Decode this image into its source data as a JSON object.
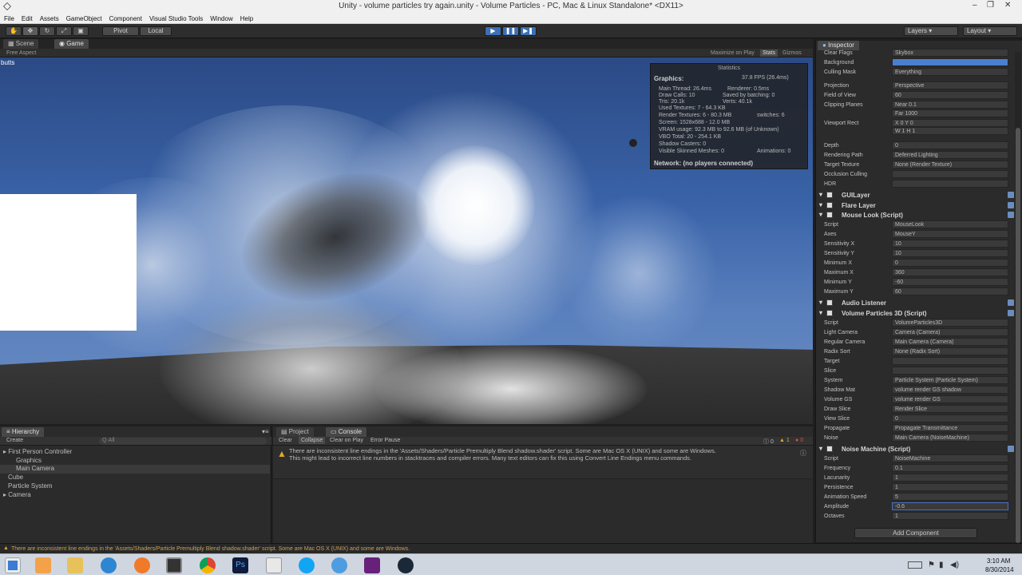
{
  "window": {
    "title": "Unity - volume particles try again.unity - Volume Particles - PC, Mac & Linux Standalone* <DX11>",
    "minimize": "–",
    "maximize": "❐",
    "close": "✕"
  },
  "menu": [
    "File",
    "Edit",
    "Assets",
    "GameObject",
    "Component",
    "Visual Studio Tools",
    "Window",
    "Help"
  ],
  "toolbar": {
    "pivot": "Pivot",
    "local": "Local",
    "layers": "Layers",
    "layout": "Layout"
  },
  "tabs": {
    "scene": "Scene",
    "game": "Game",
    "inspector": "Inspector"
  },
  "gamebar": {
    "aspect": "Free Aspect",
    "maximize": "Maximize on Play",
    "stats": "Stats",
    "gizmos": "Gizmos"
  },
  "viewport": {
    "label": "butts"
  },
  "stats": {
    "title": "Statistics",
    "graphics_label": "Graphics:",
    "fps": "37.8 FPS (26.4ms)",
    "main_thread": "Main Thread: 26.4ms",
    "renderer": "Renderer: 0.5ms",
    "draw_calls": "Draw Calls: 10",
    "saved_batching": "Saved by batching: 0",
    "tris": "Tris: 20.1k",
    "verts": "Verts: 40.1k",
    "used_textures": "Used Textures: 7 - 64.3 KB",
    "render_textures": "Render Textures: 6 - 80.3 MB",
    "switches": "switches: 6",
    "screen": "Screen: 1528x688 - 12.0 MB",
    "vram": "VRAM usage: 92.3 MB to 92.6 MB (of Unknown)",
    "vbo": "VBO Total: 20 - 254.1 KB",
    "shadow_casters": "Shadow Casters: 0",
    "skinned": "Visible Skinned Meshes: 0",
    "animations": "Animations: 0",
    "network": "Network: (no players connected)"
  },
  "inspector": {
    "camera_rows": [
      {
        "label": "Clear Flags",
        "value": "Skybox"
      },
      {
        "label": "Background",
        "value": ""
      },
      {
        "label": "Culling Mask",
        "value": "Everything"
      },
      {
        "label": "Projection",
        "value": "Perspective"
      },
      {
        "label": "Field of View",
        "value": "60"
      },
      {
        "label": "Clipping Planes",
        "value": "Near  0.1"
      },
      {
        "label": "",
        "value": "Far   1000"
      },
      {
        "label": "Viewport Rect",
        "value": "X  0          Y  0"
      },
      {
        "label": "",
        "value": "W  1          H  1"
      },
      {
        "label": "Depth",
        "value": "0"
      },
      {
        "label": "Rendering Path",
        "value": "Deferred Lighting"
      },
      {
        "label": "Target Texture",
        "value": "None (Render Texture)"
      },
      {
        "label": "Occlusion Culling",
        "value": ""
      },
      {
        "label": "HDR",
        "value": ""
      }
    ],
    "gui_layer": "GUILayer",
    "flare_layer": "Flare Layer",
    "mouse_look": "Mouse Look (Script)",
    "mouse_rows": [
      {
        "label": "Script",
        "value": "MouseLook"
      },
      {
        "label": "Axes",
        "value": "MouseY"
      },
      {
        "label": "Sensitivity X",
        "value": "10"
      },
      {
        "label": "Sensitivity Y",
        "value": "10"
      },
      {
        "label": "Minimum X",
        "value": "0"
      },
      {
        "label": "Maximum X",
        "value": "360"
      },
      {
        "label": "Minimum Y",
        "value": "-60"
      },
      {
        "label": "Maximum Y",
        "value": "60"
      }
    ],
    "audio_listener": "Audio Listener",
    "volume_particles": "Volume Particles 3D (Script)",
    "vp_rows": [
      {
        "label": "Script",
        "value": "VolumeParticles3D"
      },
      {
        "label": "Light Camera",
        "value": "Camera (Camera)"
      },
      {
        "label": "Regular Camera",
        "value": "Main Camera (Camera)"
      },
      {
        "label": "Radix Sort",
        "value": "None (Radix Sort)"
      },
      {
        "label": "Target",
        "value": ""
      },
      {
        "label": "Slice",
        "value": ""
      },
      {
        "label": "System",
        "value": "Particle System (Particle System)"
      },
      {
        "label": "Shadow Mat",
        "value": "volume render GS shadow"
      },
      {
        "label": "Volume GS",
        "value": "volume render GS"
      },
      {
        "label": "Draw Slice",
        "value": "Render Slice"
      },
      {
        "label": "View Slice",
        "value": "0"
      },
      {
        "label": "Propagate",
        "value": "Propagate Transmittance"
      },
      {
        "label": "Noise",
        "value": "Main Camera (NoiseMachine)"
      }
    ],
    "noise_machine": "Noise Machine (Script)",
    "nm_rows": [
      {
        "label": "Script",
        "value": "NoiseMachine"
      },
      {
        "label": "Frequency",
        "value": "0.1"
      },
      {
        "label": "Lacunarity",
        "value": "1"
      },
      {
        "label": "Persistence",
        "value": "1"
      },
      {
        "label": "Animation Speed",
        "value": "5"
      },
      {
        "label": "Amplitude",
        "value": "-0.6"
      },
      {
        "label": "Octaves",
        "value": "1"
      }
    ],
    "add_component": "Add Component"
  },
  "hierarchy": {
    "tab": "Hierarchy",
    "create": "Create",
    "search": "Q·All",
    "items": [
      "First Person Controller",
      "Graphics",
      "Main Camera",
      "Cube",
      "Particle System",
      "Camera"
    ]
  },
  "console": {
    "project_tab": "Project",
    "console_tab": "Console",
    "clear": "Clear",
    "collapse": "Collapse",
    "clear_on_play": "Clear on Play",
    "error_pause": "Error Pause",
    "count_info": "0",
    "count_warn": "1",
    "count_error": "0",
    "message_line1": "There are inconsistent line endings in the 'Assets/Shaders/Particle Premultiply Blend shadow.shader' script. Some are Mac OS X (UNIX) and some are Windows.",
    "message_line2": "This might lead to incorrect line numbers in stacktraces and compiler errors. Many text editors can fix this using Convert Line Endings menu commands."
  },
  "status_message": "There are inconsistent line endings in the 'Assets/Shaders/Particle Premultiply Blend shadow.shader' script. Some are Mac OS X (UNIX) and some are Windows.",
  "clock": {
    "time": "3:10 AM",
    "date": "8/30/2014"
  },
  "colors": {
    "sky": "#3a63a8",
    "accent": "#4a7fd0",
    "warning": "#e0a92a"
  }
}
